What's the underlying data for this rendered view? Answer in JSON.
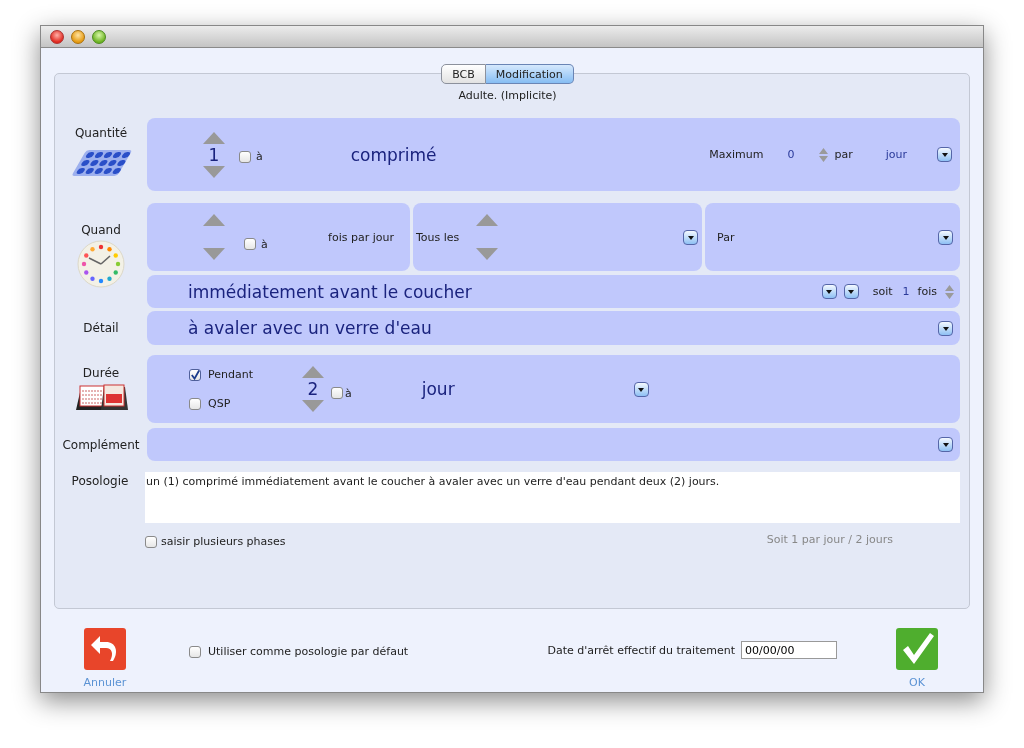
{
  "tabs": [
    {
      "label": "BCB",
      "selected": false
    },
    {
      "label": "Modification",
      "selected": true
    }
  ],
  "profile": "Adulte. (Implicite)",
  "quantite": {
    "label": "Quantité",
    "value": "1",
    "range_checked": false,
    "range_label": "à",
    "unit": "comprimé",
    "max_label": "Maximum",
    "max_value": "0",
    "per_label": "par",
    "per_unit": "jour"
  },
  "quand": {
    "label": "Quand",
    "range_checked": false,
    "range_label": "à",
    "times_label": "fois par jour",
    "every_label": "Tous les",
    "by_label": "Par",
    "moment": "immédiatement avant le coucher",
    "soit_label": "soit",
    "soit_value": "1",
    "fois_label": "fois"
  },
  "detail": {
    "label": "Détail",
    "value": "à avaler avec un verre d'eau"
  },
  "duree": {
    "label": "Durée",
    "options": [
      {
        "label": "Pendant",
        "checked": true
      },
      {
        "label": "QSP",
        "checked": false
      }
    ],
    "value": "2",
    "range_checked": false,
    "range_label": "à",
    "unit": "jour"
  },
  "complement": {
    "label": "Complément"
  },
  "posologie": {
    "label": "Posologie",
    "text": "un (1) comprimé immédiatement avant le coucher à avaler avec un verre d'eau pendant deux (2) jours.",
    "multi_phase": {
      "label": "saisir plusieurs phases",
      "checked": false
    },
    "summary": "Soit 1 par jour / 2 jours"
  },
  "footer": {
    "cancel": "Annuler",
    "default": {
      "label": "Utiliser comme posologie par défaut",
      "checked": false
    },
    "stop_date_label": "Date d'arrêt effectif du traitement",
    "stop_date": "00/00/00",
    "ok": "OK"
  }
}
